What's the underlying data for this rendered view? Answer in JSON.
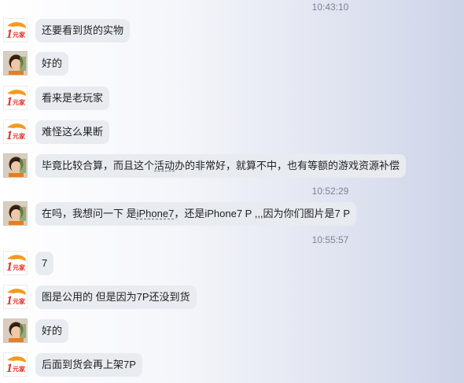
{
  "timestamps": [
    "10:43:10",
    "10:52:29",
    "10:55:57"
  ],
  "messages": [
    {
      "sender": "shop",
      "avatar_icon": "shop-logo-icon",
      "segments": [
        "还要看到货的实物"
      ]
    },
    {
      "sender": "user",
      "avatar_icon": "user-avatar-icon",
      "segments": [
        "好的"
      ]
    },
    {
      "sender": "shop",
      "avatar_icon": "shop-logo-icon",
      "segments": [
        "看来是老玩家"
      ]
    },
    {
      "sender": "shop",
      "avatar_icon": "shop-logo-icon",
      "segments": [
        "难怪这么果断"
      ]
    },
    {
      "sender": "user",
      "avatar_icon": "user-avatar-icon",
      "segments": [
        "毕竟比较合算，而且这个",
        "活动",
        "办的非常好，就算不中，也有等额的游戏资源补偿"
      ]
    },
    {
      "sender": "user",
      "avatar_icon": "user-avatar-icon",
      "segments": [
        "在吗，我想问一下 是",
        "iPhone7",
        "，还是iPhone7 P ,,,因为你们图片是7 P"
      ]
    },
    {
      "sender": "shop",
      "avatar_icon": "shop-logo-icon",
      "segments": [
        "7"
      ]
    },
    {
      "sender": "shop",
      "avatar_icon": "shop-logo-icon",
      "segments": [
        "图是公用的 但是因为7P还没到货"
      ]
    },
    {
      "sender": "user",
      "avatar_icon": "user-avatar-icon",
      "segments": [
        "好的"
      ]
    },
    {
      "sender": "shop",
      "avatar_icon": "shop-logo-icon",
      "segments": [
        "后面到货会再上架7P"
      ]
    }
  ],
  "colors": {
    "bubble": "#e8ebf0",
    "brand_orange": "#f39a1e",
    "brand_red": "#e0302a",
    "timestamp": "#7d8290"
  }
}
